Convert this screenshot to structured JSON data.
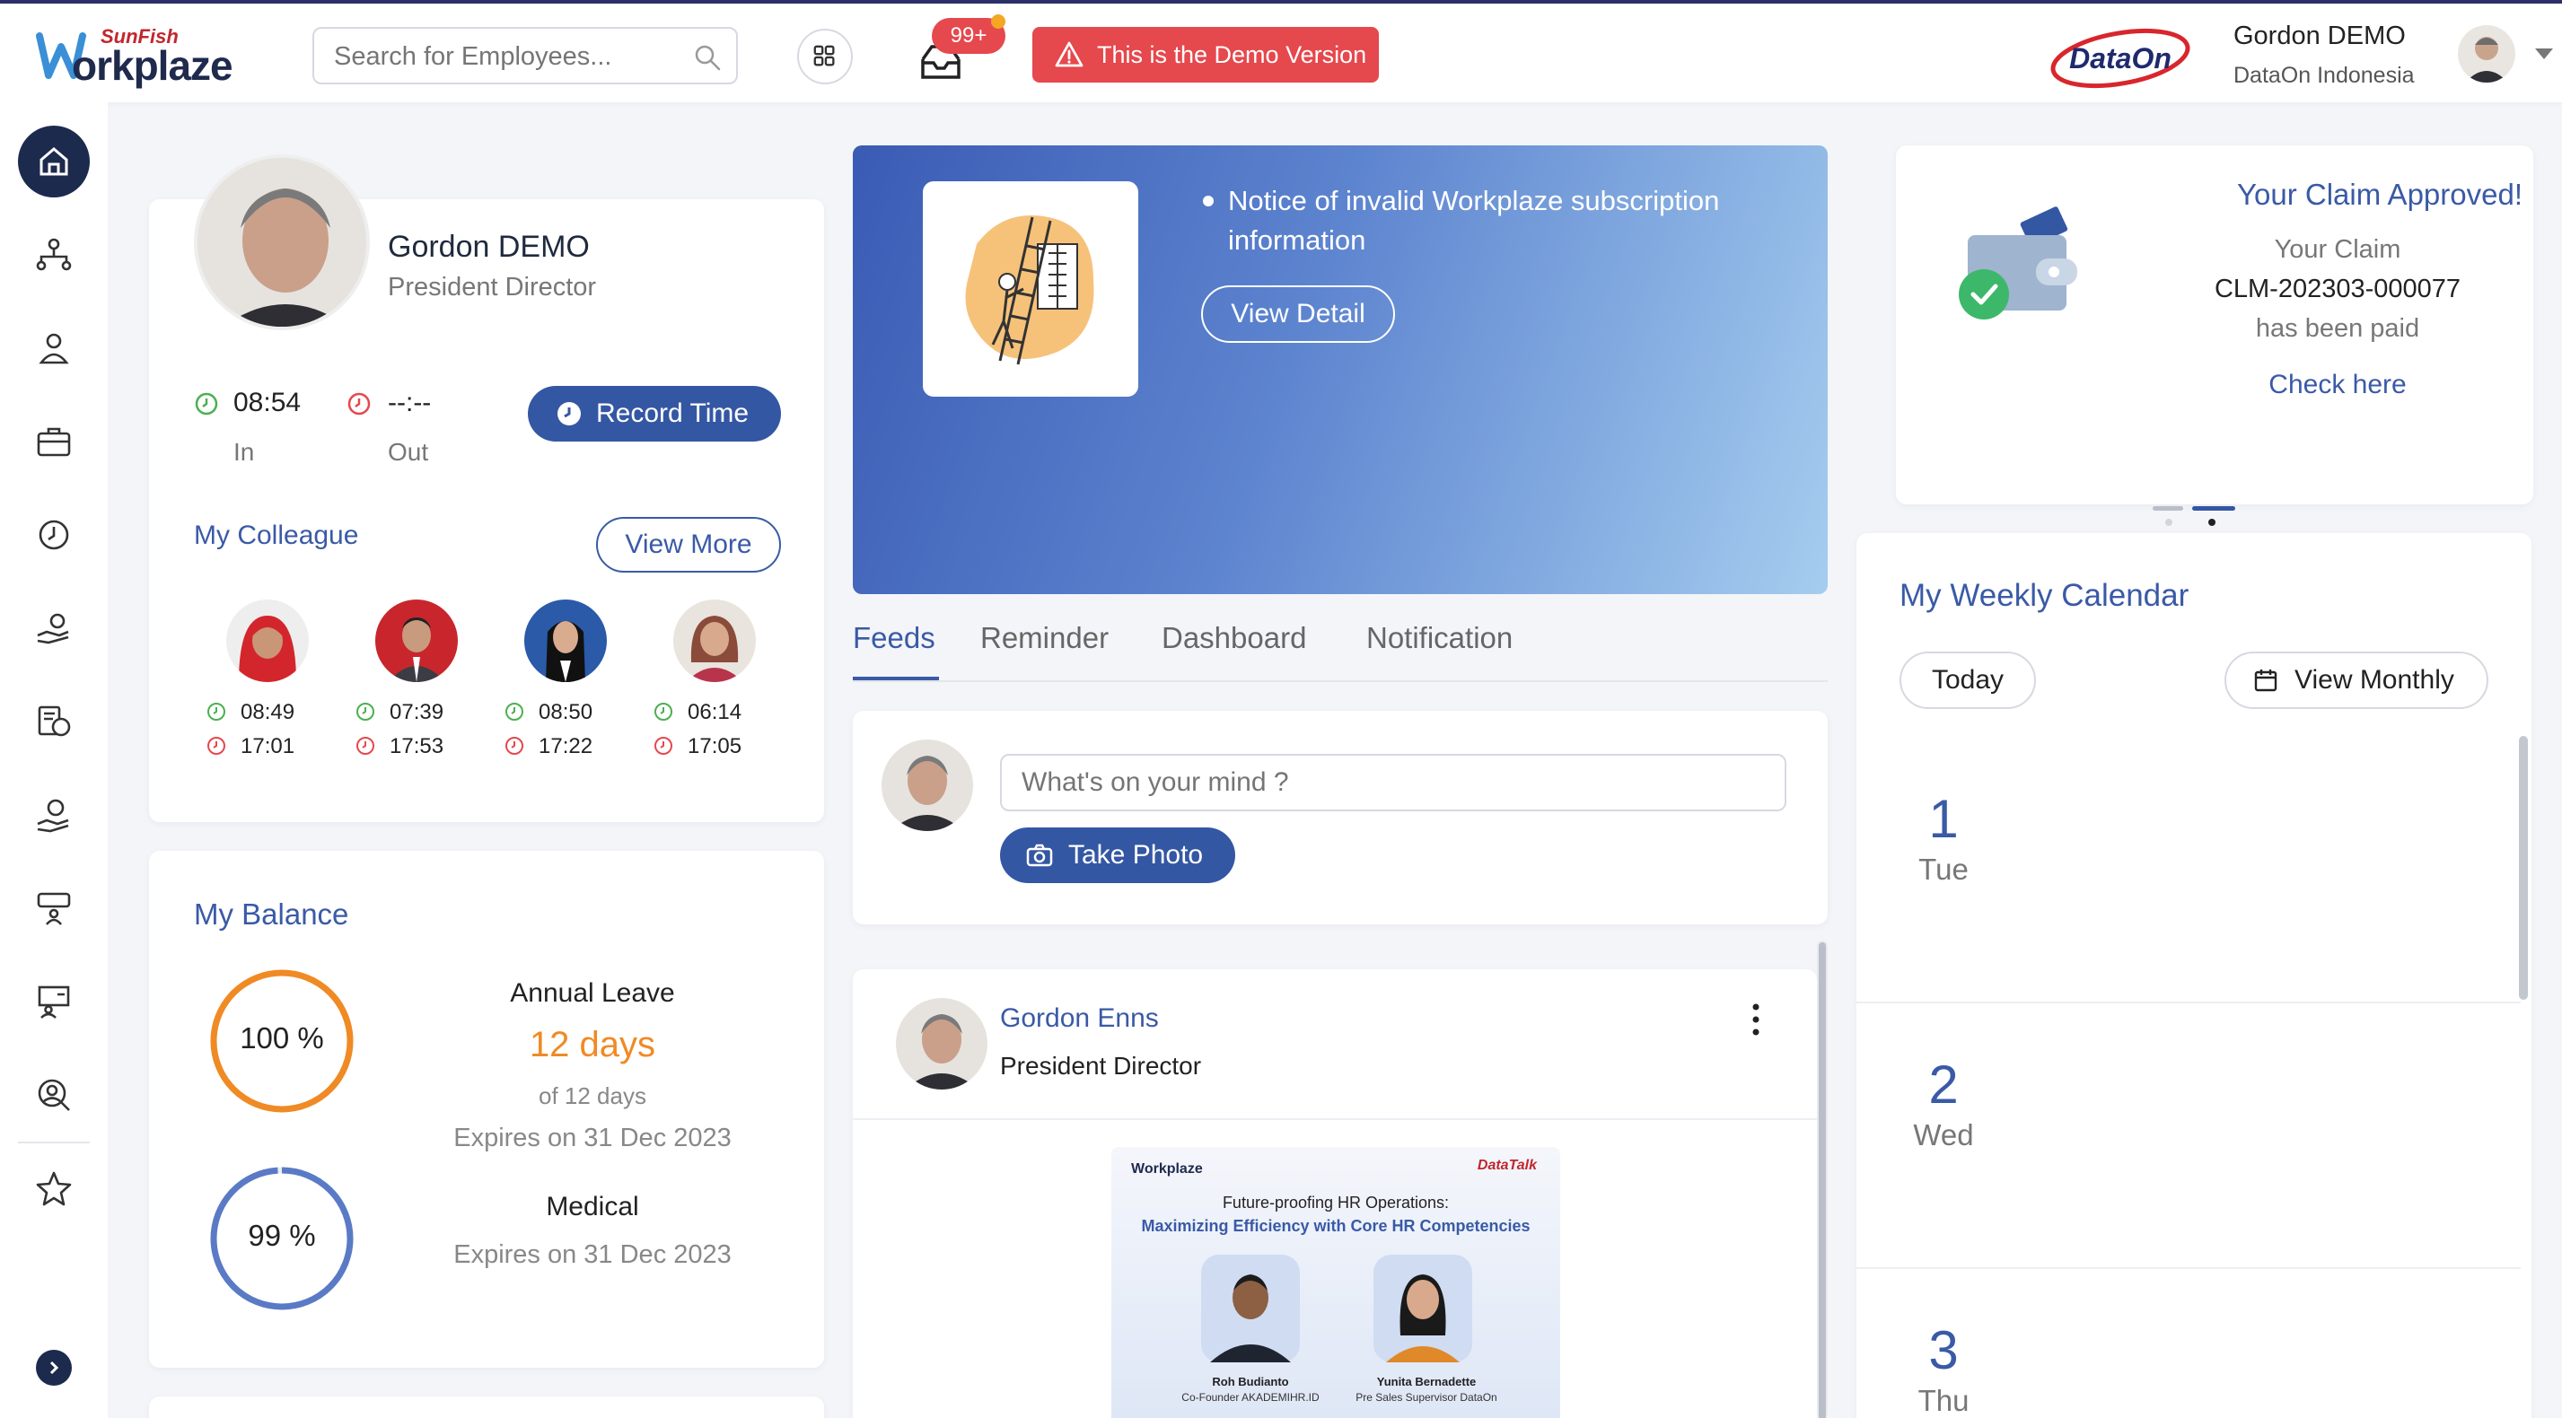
{
  "header": {
    "logo_small": "SunFish",
    "logo_big": "orkplaze",
    "search_placeholder": "Search for Employees...",
    "notification_badge": "99+",
    "demo_banner": "This is the Demo Version",
    "partner_logo": "DataOn",
    "user_name": "Gordon DEMO",
    "user_company": "DataOn Indonesia"
  },
  "sidebar": {
    "items": [
      {
        "icon": "home-icon",
        "active": true
      },
      {
        "icon": "org-chart-icon"
      },
      {
        "icon": "person-icon"
      },
      {
        "icon": "briefcase-icon"
      },
      {
        "icon": "clock-icon"
      },
      {
        "icon": "hand-money-icon"
      },
      {
        "icon": "payroll-icon"
      },
      {
        "icon": "benefit-icon"
      },
      {
        "icon": "training-icon"
      },
      {
        "icon": "presentation-icon"
      },
      {
        "icon": "talent-search-icon"
      },
      {
        "icon": "star-icon"
      }
    ]
  },
  "profile": {
    "name": "Gordon DEMO",
    "title": "President Director",
    "time_in": "08:54",
    "time_in_label": "In",
    "time_out": "--:--",
    "time_out_label": "Out",
    "record_button": "Record Time",
    "colleague_title": "My Colleague",
    "view_more_button": "View More",
    "colleagues": [
      {
        "in": "08:49",
        "out": "17:01"
      },
      {
        "in": "07:39",
        "out": "17:53"
      },
      {
        "in": "08:50",
        "out": "17:22"
      },
      {
        "in": "06:14",
        "out": "17:05"
      }
    ]
  },
  "balance": {
    "title": "My Balance",
    "items": [
      {
        "percent": "100 %",
        "percent_value": 100,
        "name": "Annual Leave",
        "days": "12 days",
        "of": "of 12 days",
        "expires": "Expires on 31 Dec 2023",
        "color": "#f08a24"
      },
      {
        "percent": "99 %",
        "percent_value": 99,
        "name": "Medical",
        "expires": "Expires on 31 Dec 2023",
        "color": "#5b7ac6"
      }
    ]
  },
  "banner": {
    "text": "Notice of invalid Workplaze subscription information",
    "button": "View Detail"
  },
  "tabs": [
    "Feeds",
    "Reminder",
    "Dashboard",
    "Notification"
  ],
  "post": {
    "placeholder": "What's on your mind ?",
    "take_photo_button": "Take Photo"
  },
  "feed": {
    "author": "Gordon Enns",
    "role": "President Director",
    "image": {
      "logo": "Workplaze",
      "brand": "DataTalk",
      "title": "Future-proofing HR Operations:",
      "subtitle": "Maximizing Efficiency with Core HR Competencies",
      "speaker1_name": "Roh Budianto",
      "speaker1_role": "Co-Founder AKADEMIHR.ID",
      "speaker2_name": "Yunita Bernadette",
      "speaker2_role": "Pre Sales Supervisor DataOn"
    }
  },
  "claim": {
    "title": "Your Claim Approved!",
    "line1": "Your Claim",
    "claim_id": "CLM-202303-000077",
    "line3": "has been paid",
    "link": "Check here"
  },
  "calendar": {
    "title": "My Weekly Calendar",
    "today_button": "Today",
    "monthly_button": "View Monthly",
    "days": [
      {
        "num": "1",
        "name": "Tue"
      },
      {
        "num": "2",
        "name": "Wed"
      },
      {
        "num": "3",
        "name": "Thu"
      }
    ]
  },
  "colors": {
    "accent": "#3457a3",
    "link": "#3a5aa6",
    "danger": "#e5484d",
    "sidebar_active": "#1c2a4d",
    "time_in": "#4caf50",
    "time_out": "#e5484d"
  }
}
